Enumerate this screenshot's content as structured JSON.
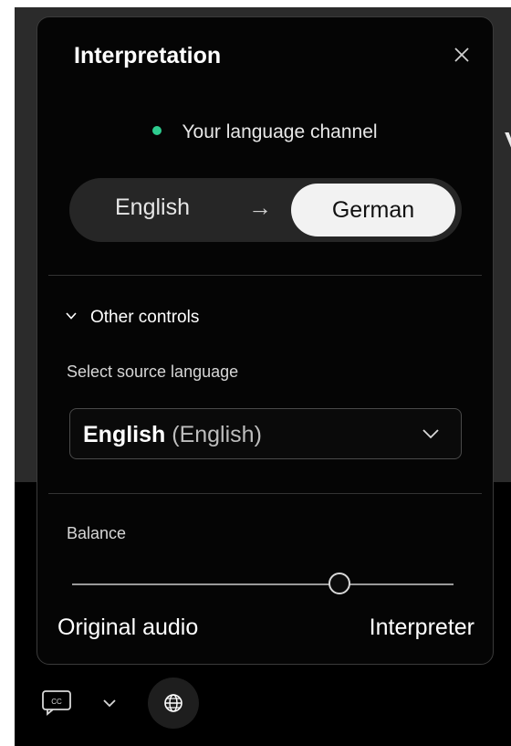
{
  "panel": {
    "title": "Interpretation",
    "close_icon": "close-icon"
  },
  "channel": {
    "label": "Your language channel",
    "status_color": "#2ecc8f",
    "from": "English",
    "arrow": "→",
    "to": "German"
  },
  "other_controls": {
    "label": "Other controls",
    "expanded": true
  },
  "source_language": {
    "label": "Select source language",
    "value_primary": "English",
    "value_secondary": "(English)"
  },
  "balance": {
    "label": "Balance",
    "value": 0.7,
    "min_label": "Original audio",
    "max_label": "Interpreter"
  },
  "background": {
    "peek_text": "V"
  },
  "toolbar": {
    "cc_icon": "closed-captions-icon",
    "chevron_icon": "chevron-down-icon",
    "globe_icon": "globe-icon"
  }
}
